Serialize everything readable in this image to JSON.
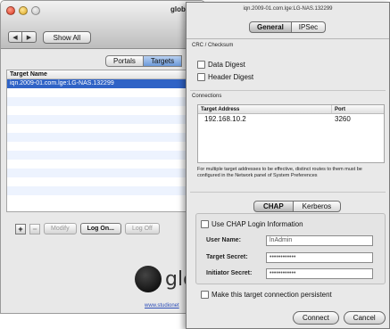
{
  "back_window": {
    "title": "global",
    "nav_back": "◀",
    "nav_forward": "▶",
    "show_all": "Show All",
    "tabs": [
      {
        "label": "Portals",
        "active": false
      },
      {
        "label": "Targets",
        "active": true
      }
    ],
    "list_header": "Target Name",
    "targets": [
      "iqn.2009-01.com.lge:LG-NAS.132299"
    ],
    "buttons": {
      "add": "+",
      "remove": "−",
      "modify": "Modify",
      "log_on": "Log On...",
      "log_off": "Log Off"
    },
    "logo_text": "glo",
    "weblink": "www.studionet"
  },
  "sheet": {
    "title": "iqn.2009-01.com.lge:LG-NAS.132299",
    "tabs": [
      {
        "label": "General",
        "active": true
      },
      {
        "label": "IPSec",
        "active": false
      }
    ],
    "crc_label": "CRC / Checksum",
    "data_digest": "Data Digest",
    "header_digest": "Header Digest",
    "connections_label": "Connections",
    "table_headers": {
      "address": "Target Address",
      "port": "Port"
    },
    "connections": [
      {
        "address": "192.168.10.2",
        "port": "3260"
      }
    ],
    "note": "For multiple target addresses to be effective, distinct routes to them must be configured in the Network panel of System Preferences",
    "auth_tabs": [
      {
        "label": "CHAP",
        "active": true
      },
      {
        "label": "Kerberos",
        "active": false
      }
    ],
    "use_chap": "Use CHAP Login Information",
    "user_name_label": "User Name:",
    "user_name_value": "lnAdmin",
    "target_secret_label": "Target Secret:",
    "target_secret_value": "••••••••••••",
    "initiator_secret_label": "Initiator Secret:",
    "initiator_secret_value": "••••••••••••",
    "persistent": "Make this target connection persistent",
    "connect": "Connect",
    "cancel": "Cancel"
  }
}
